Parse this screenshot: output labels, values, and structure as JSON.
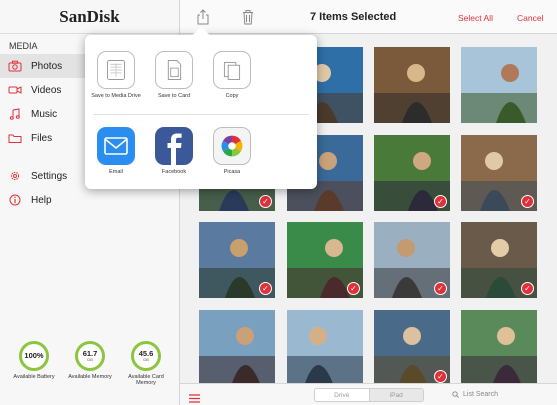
{
  "brand": "SanDisk",
  "sidebar": {
    "section_label": "MEDIA",
    "items": [
      {
        "label": "Photos",
        "icon": "camera-icon",
        "active": true
      },
      {
        "label": "Videos",
        "icon": "video-icon"
      },
      {
        "label": "Music",
        "icon": "music-icon"
      },
      {
        "label": "Files",
        "icon": "folder-icon"
      }
    ],
    "bottom_items": [
      {
        "label": "Settings",
        "icon": "gear-icon"
      },
      {
        "label": "Help",
        "icon": "info-icon"
      }
    ]
  },
  "meters": [
    {
      "value": "100%",
      "unit": "",
      "label": "Available Battery"
    },
    {
      "value": "61.7",
      "unit": "GB",
      "label": "Available Memory"
    },
    {
      "value": "45.6",
      "unit": "GB",
      "label": "Available Card Memory"
    }
  ],
  "topbar": {
    "title": "7 Items Selected",
    "select_all": "Select All",
    "cancel": "Cancel"
  },
  "share": {
    "row1": [
      {
        "label": "Save to Media Drive",
        "icon": "media-drive-icon"
      },
      {
        "label": "Save to Card",
        "icon": "sd-card-icon"
      },
      {
        "label": "Copy",
        "icon": "copy-icon"
      }
    ],
    "row2": [
      {
        "label": "Email",
        "icon": "email-icon"
      },
      {
        "label": "Facebook",
        "icon": "facebook-icon"
      },
      {
        "label": "Picasa",
        "icon": "picasa-icon"
      }
    ]
  },
  "bottombar": {
    "segments": [
      "Drive",
      "iPad"
    ],
    "search_label": "List Search"
  },
  "photos": [
    {
      "selected": false
    },
    {
      "selected": false
    },
    {
      "selected": false
    },
    {
      "selected": false
    },
    {
      "selected": true
    },
    {
      "selected": false
    },
    {
      "selected": true
    },
    {
      "selected": true
    },
    {
      "selected": true
    },
    {
      "selected": true
    },
    {
      "selected": true
    },
    {
      "selected": true
    },
    {
      "selected": false
    },
    {
      "selected": false
    },
    {
      "selected": true
    },
    {
      "selected": false
    }
  ],
  "colors": {
    "accent": "#e0313b",
    "meter_ring": "#8cc63f",
    "facebook": "#3b5998",
    "email": "#2a8df0"
  }
}
